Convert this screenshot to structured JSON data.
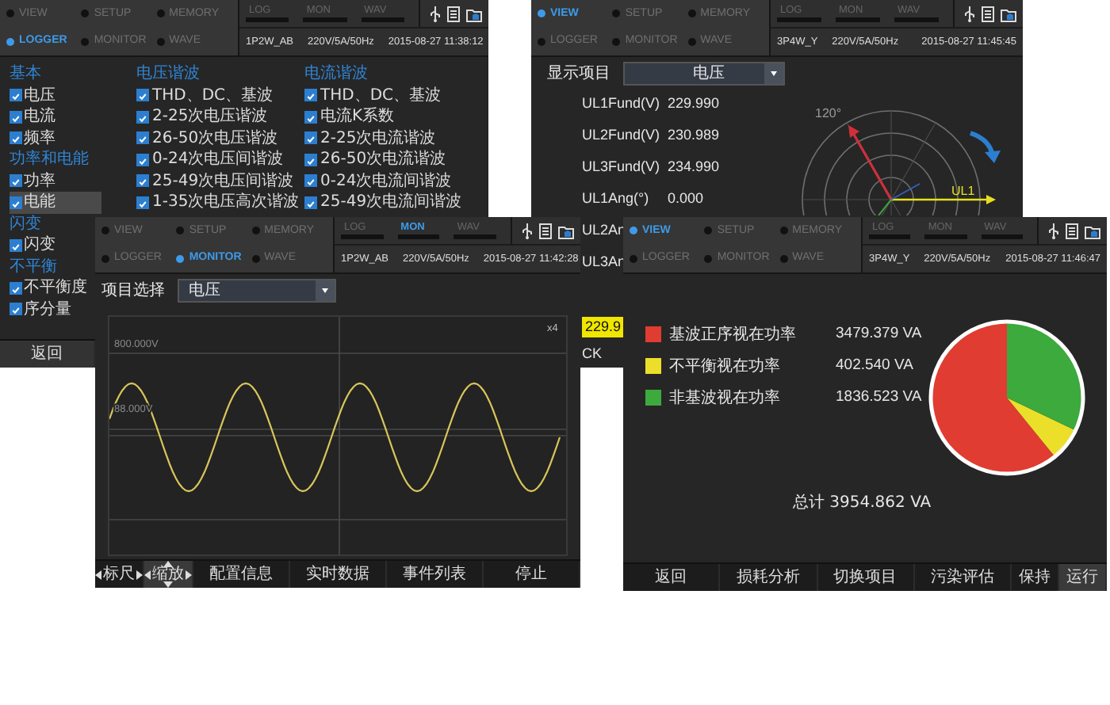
{
  "logger_screen": {
    "header": {
      "menu": [
        {
          "label": "VIEW",
          "selected": false
        },
        {
          "label": "SETUP",
          "selected": false
        },
        {
          "label": "MEMORY",
          "selected": false
        },
        {
          "label": "LOGGER",
          "selected": true
        },
        {
          "label": "MONITOR",
          "selected": false
        },
        {
          "label": "WAVE",
          "selected": false
        }
      ],
      "modes": [
        {
          "label": "LOG",
          "active": false
        },
        {
          "label": "MON",
          "active": false
        },
        {
          "label": "WAV",
          "active": false
        }
      ],
      "wiring": "1P2W_AB",
      "range": "220V/5A/50Hz",
      "datetime": "2015-08-27 11:38:12"
    },
    "columns": [
      {
        "items": [
          {
            "kind": "heading",
            "label": "基本"
          },
          {
            "kind": "check",
            "label": "电压",
            "checked": true,
            "selected": false
          },
          {
            "kind": "check",
            "label": "电流",
            "checked": true,
            "selected": false
          },
          {
            "kind": "check",
            "label": "频率",
            "checked": true,
            "selected": false
          },
          {
            "kind": "heading",
            "label": "功率和电能"
          },
          {
            "kind": "check",
            "label": "功率",
            "checked": true,
            "selected": false
          },
          {
            "kind": "check",
            "label": "电能",
            "checked": true,
            "selected": true
          },
          {
            "kind": "heading",
            "label": "闪变"
          },
          {
            "kind": "check",
            "label": "闪变",
            "checked": true,
            "selected": false
          },
          {
            "kind": "heading",
            "label": "不平衡"
          },
          {
            "kind": "check",
            "label": "不平衡度",
            "checked": true,
            "selected": false
          },
          {
            "kind": "check",
            "label": "序分量",
            "checked": true,
            "selected": false
          }
        ]
      },
      {
        "items": [
          {
            "kind": "heading",
            "label": "电压谐波"
          },
          {
            "kind": "check",
            "label": "THD、DC、基波",
            "checked": true,
            "selected": false
          },
          {
            "kind": "check",
            "label": "2-25次电压谐波",
            "checked": true,
            "selected": false
          },
          {
            "kind": "check",
            "label": "26-50次电压谐波",
            "checked": true,
            "selected": false
          },
          {
            "kind": "check",
            "label": "0-24次电压间谐波",
            "checked": true,
            "selected": false
          },
          {
            "kind": "check",
            "label": "25-49次电压间谐波",
            "checked": true,
            "selected": false
          },
          {
            "kind": "check",
            "label": "1-35次电压高次谐波",
            "checked": true,
            "selected": false
          }
        ]
      },
      {
        "items": [
          {
            "kind": "heading",
            "label": "电流谐波"
          },
          {
            "kind": "check",
            "label": "THD、DC、基波",
            "checked": true,
            "selected": false
          },
          {
            "kind": "check",
            "label": "电流K系数",
            "checked": true,
            "selected": false
          },
          {
            "kind": "check",
            "label": "2-25次电流谐波",
            "checked": true,
            "selected": false
          },
          {
            "kind": "check",
            "label": "26-50次电流谐波",
            "checked": true,
            "selected": false
          },
          {
            "kind": "check",
            "label": "0-24次电流间谐波",
            "checked": true,
            "selected": false
          },
          {
            "kind": "check",
            "label": "25-49次电流间谐波",
            "checked": true,
            "selected": false
          }
        ]
      }
    ],
    "footer": [
      {
        "label": "返回"
      }
    ]
  },
  "vector_screen": {
    "header": {
      "menu": [
        {
          "label": "VIEW",
          "selected": true
        },
        {
          "label": "SETUP",
          "selected": false
        },
        {
          "label": "MEMORY",
          "selected": false
        },
        {
          "label": "LOGGER",
          "selected": false
        },
        {
          "label": "MONITOR",
          "selected": false
        },
        {
          "label": "WAVE",
          "selected": false
        }
      ],
      "modes": [
        {
          "label": "LOG",
          "active": false
        },
        {
          "label": "MON",
          "active": false
        },
        {
          "label": "WAV",
          "active": false
        }
      ],
      "wiring": "3P4W_Y",
      "range": "220V/5A/50Hz",
      "datetime": "2015-08-27 11:45:45"
    },
    "selector": {
      "label": "显示项目",
      "value": "电压"
    },
    "readings": [
      {
        "name": "UL1Fund(V)",
        "value": "229.990"
      },
      {
        "name": "UL2Fund(V)",
        "value": "230.989"
      },
      {
        "name": "UL3Fund(V)",
        "value": "234.990"
      },
      {
        "name": "UL1Ang(°)",
        "value": "0.000"
      },
      {
        "name": "UL2An"
      },
      {
        "name": "UL3An"
      }
    ],
    "highlight_value": "229.9",
    "footer_fragment": "CK",
    "phasor": {
      "angle_label": "120°",
      "phase_label": "UL1"
    }
  },
  "monitor_screen": {
    "header": {
      "menu": [
        {
          "label": "VIEW",
          "selected": false
        },
        {
          "label": "SETUP",
          "selected": false
        },
        {
          "label": "MEMORY",
          "selected": false
        },
        {
          "label": "LOGGER",
          "selected": false
        },
        {
          "label": "MONITOR",
          "selected": true
        },
        {
          "label": "WAVE",
          "selected": false
        }
      ],
      "modes": [
        {
          "label": "LOG",
          "active": false
        },
        {
          "label": "MON",
          "active": true
        },
        {
          "label": "WAV",
          "active": false
        }
      ],
      "wiring": "1P2W_AB",
      "range": "220V/5A/50Hz",
      "datetime": "2015-08-27 11:42:28"
    },
    "selector": {
      "label": "项目选择",
      "value": "电压"
    },
    "waveform": {
      "top_label": "800.000V",
      "mid_label": "88.000V",
      "zoom_label": "x4"
    },
    "footer": [
      {
        "label": "标尺",
        "kind": "pan",
        "selected": false
      },
      {
        "label": "缩放",
        "kind": "zoom",
        "selected": true
      },
      {
        "label": "配置信息",
        "kind": "plain",
        "selected": false
      },
      {
        "label": "实时数据",
        "kind": "plain",
        "selected": false
      },
      {
        "label": "事件列表",
        "kind": "plain",
        "selected": false
      },
      {
        "label": "停止",
        "kind": "plain",
        "selected": false
      }
    ]
  },
  "power_screen": {
    "header": {
      "menu": [
        {
          "label": "VIEW",
          "selected": true
        },
        {
          "label": "SETUP",
          "selected": false
        },
        {
          "label": "MEMORY",
          "selected": false
        },
        {
          "label": "LOGGER",
          "selected": false
        },
        {
          "label": "MONITOR",
          "selected": false
        },
        {
          "label": "WAVE",
          "selected": false
        }
      ],
      "modes": [
        {
          "label": "LOG",
          "active": false
        },
        {
          "label": "MON",
          "active": false
        },
        {
          "label": "WAV",
          "active": false
        }
      ],
      "wiring": "3P4W_Y",
      "range": "220V/5A/50Hz",
      "datetime": "2015-08-27 11:46:47"
    },
    "legend": [
      {
        "value": "3479.379 VA",
        "color": "#e03c31"
      },
      {
        "value": "402.540 VA",
        "color": "#ecdf2a"
      },
      {
        "value": "1836.523 VA",
        "color": "#3caa3c"
      }
    ],
    "chart_data": {
      "type": "pie",
      "categories": [
        "基波正序视在功率",
        "不平衡视在功率",
        "非基波视在功率"
      ],
      "values": [
        60.85,
        7.04,
        32.11
      ]
    },
    "total": "总计 3954.862 VA",
    "footer": [
      {
        "label": "返回",
        "selected": false
      },
      {
        "label": "损耗分析",
        "selected": false
      },
      {
        "label": "切换项目",
        "selected": false
      },
      {
        "label": "污染评估",
        "selected": false
      },
      {
        "label": "保持",
        "selected": false
      },
      {
        "label": "运行",
        "selected": true
      }
    ]
  }
}
